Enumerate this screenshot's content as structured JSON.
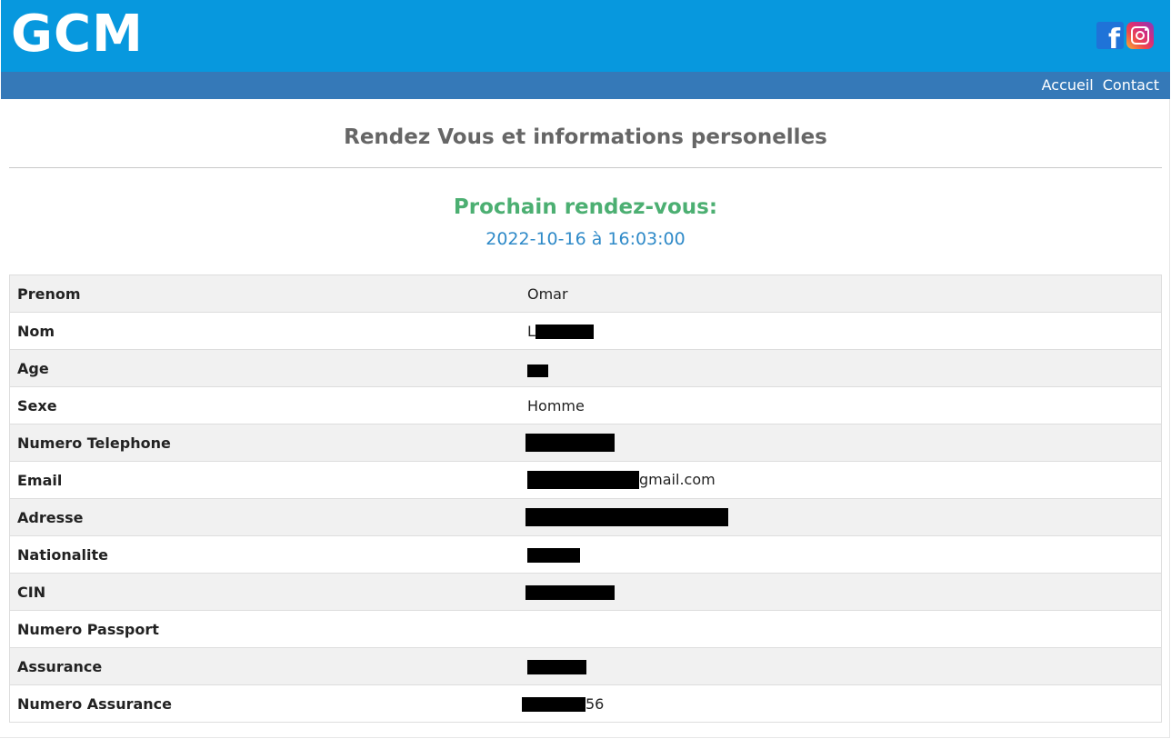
{
  "header": {
    "logo": "GCM",
    "social": [
      "facebook-icon",
      "instagram-icon"
    ],
    "colors": {
      "header_bg": "#0798de",
      "navbar_bg": "#3579b8"
    }
  },
  "nav": {
    "items": [
      {
        "label": "Accueil"
      },
      {
        "label": "Contact"
      }
    ]
  },
  "main": {
    "title": "Rendez Vous et informations personelles",
    "next_label": "Prochain rendez-vous:",
    "next_date": "2022-10-16 à 16:03:00",
    "colors": {
      "next_label": "#4caf72",
      "next_date": "#2f8ac8"
    }
  },
  "info": {
    "rows": [
      {
        "key": "Prenom",
        "prefix": "Omar",
        "suffix": ""
      },
      {
        "key": "Nom",
        "prefix": "L",
        "suffix": ""
      },
      {
        "key": "Age",
        "prefix": "",
        "suffix": ""
      },
      {
        "key": "Sexe",
        "prefix": "Homme",
        "suffix": ""
      },
      {
        "key": "Numero Telephone",
        "prefix": "",
        "suffix": ""
      },
      {
        "key": "Email",
        "prefix": "",
        "suffix": "gmail.com"
      },
      {
        "key": "Adresse",
        "prefix": "",
        "suffix": ""
      },
      {
        "key": "Nationalite",
        "prefix": "",
        "suffix": ""
      },
      {
        "key": "CIN",
        "prefix": "",
        "suffix": ""
      },
      {
        "key": "Numero Passport",
        "prefix": "",
        "suffix": ""
      },
      {
        "key": "Assurance",
        "prefix": "",
        "suffix": ""
      },
      {
        "key": "Numero Assurance",
        "prefix": "",
        "suffix": "56"
      }
    ]
  }
}
